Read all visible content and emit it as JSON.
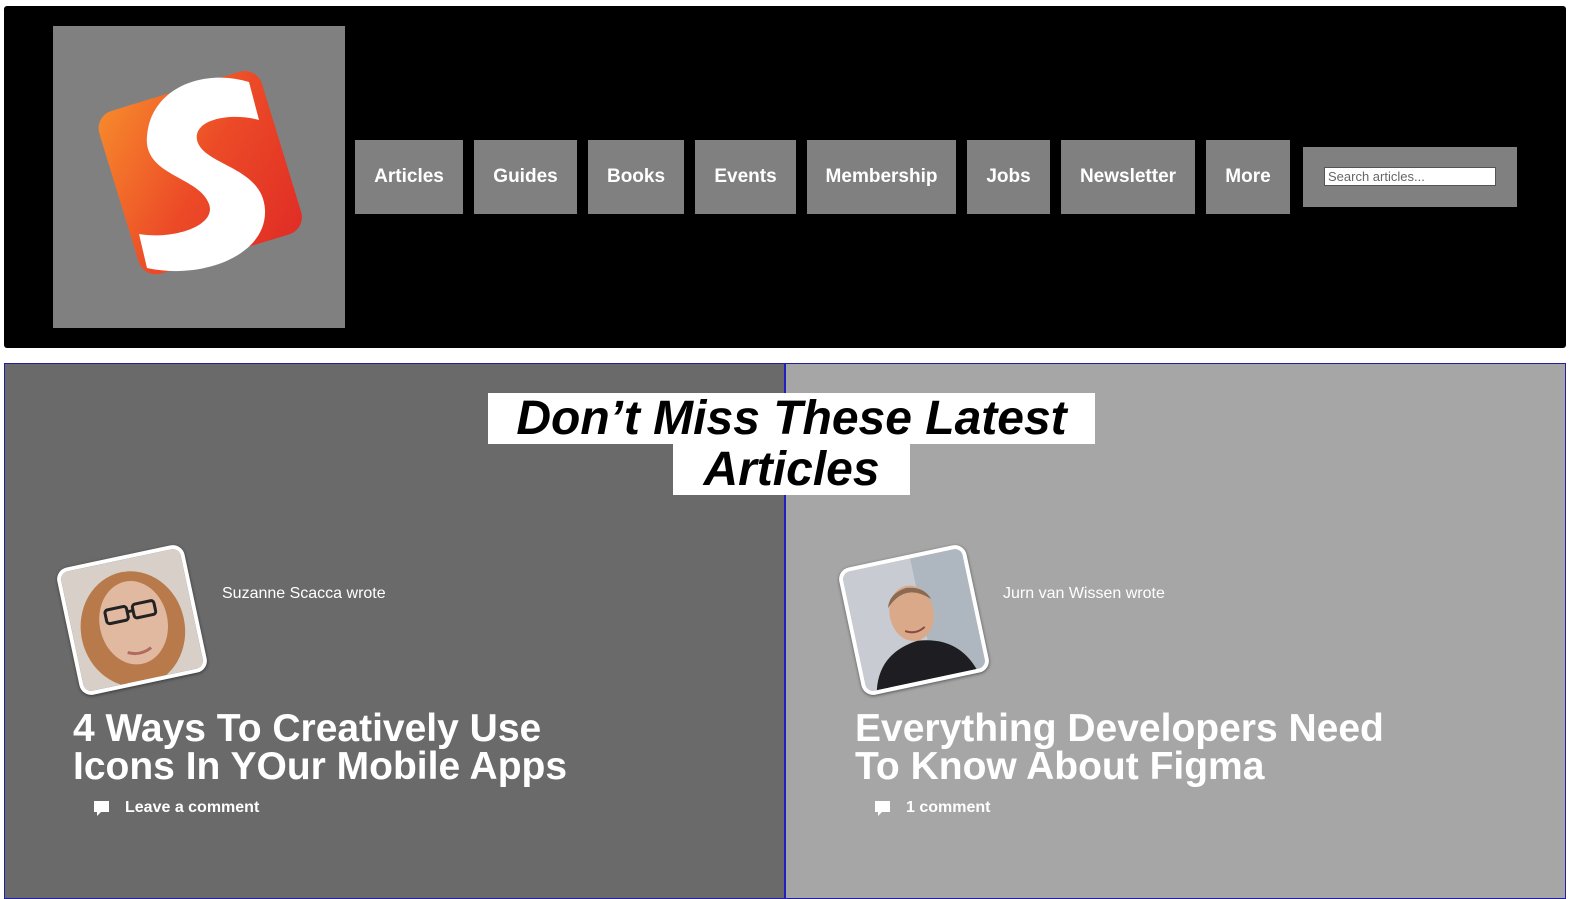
{
  "header": {
    "logo_alt": "S",
    "nav": [
      {
        "label": "Articles"
      },
      {
        "label": "Guides"
      },
      {
        "label": "Books"
      },
      {
        "label": "Events"
      },
      {
        "label": "Membership"
      },
      {
        "label": "Jobs"
      },
      {
        "label": "Newsletter"
      },
      {
        "label": "More"
      }
    ],
    "search": {
      "placeholder": "Search articles..."
    }
  },
  "latest": {
    "heading_line1": "Don’t Miss These Latest",
    "heading_line2": "Articles",
    "articles": [
      {
        "author": "Suzanne Scacca wrote",
        "title": "4 Ways To Creatively Use Icons In YOur Mobile Apps",
        "comments": "Leave a comment",
        "panel_color": "#6a6a6a"
      },
      {
        "author": "Jurn van Wissen wrote",
        "title": "Everything Developers Need To Know About Figma",
        "comments": "1 comment",
        "panel_color": "#a6a6a6"
      }
    ]
  },
  "colors": {
    "header_bg": "#000000",
    "nav_bg": "#808080",
    "logo_orange": "#f0602a",
    "logo_red": "#e5332a"
  }
}
